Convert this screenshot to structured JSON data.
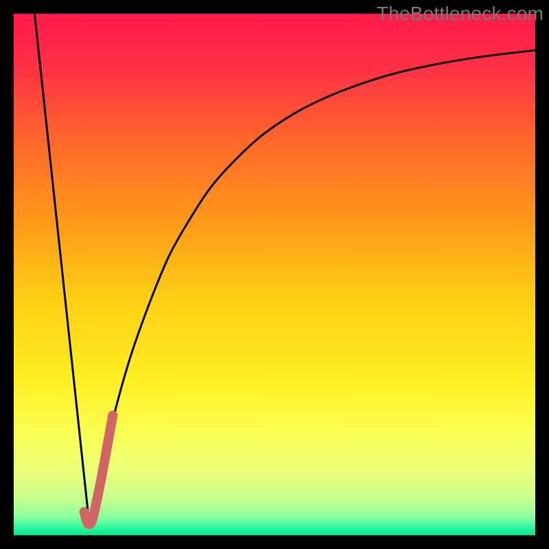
{
  "watermark": "TheBottleneck.com",
  "chart_data": {
    "type": "line",
    "title": "",
    "xlabel": "",
    "ylabel": "",
    "xlim": [
      0,
      100
    ],
    "ylim": [
      0,
      100
    ],
    "grid": false,
    "legend": false,
    "gradient_stops": [
      {
        "offset": 0.0,
        "color": "#ff1a4b"
      },
      {
        "offset": 0.1,
        "color": "#ff2f45"
      },
      {
        "offset": 0.25,
        "color": "#ff6a2a"
      },
      {
        "offset": 0.4,
        "color": "#ff9a1a"
      },
      {
        "offset": 0.55,
        "color": "#ffd014"
      },
      {
        "offset": 0.7,
        "color": "#ffee22"
      },
      {
        "offset": 0.8,
        "color": "#fbff51"
      },
      {
        "offset": 0.88,
        "color": "#eaff7a"
      },
      {
        "offset": 0.93,
        "color": "#c7ff8e"
      },
      {
        "offset": 0.965,
        "color": "#8affa0"
      },
      {
        "offset": 0.985,
        "color": "#2ff7a1"
      },
      {
        "offset": 1.0,
        "color": "#00e884"
      }
    ],
    "series": [
      {
        "name": "left-line",
        "stroke": "#000000",
        "stroke_width": 3,
        "x": [
          4,
          14.5
        ],
        "y": [
          100,
          2
        ]
      },
      {
        "name": "right-curve",
        "stroke": "#000000",
        "stroke_width": 3,
        "x": [
          14.5,
          16,
          18,
          20,
          22,
          24,
          27,
          30,
          34,
          38,
          43,
          48,
          54,
          60,
          67,
          74,
          82,
          90,
          100
        ],
        "y": [
          2,
          9,
          18,
          26,
          33,
          39,
          47,
          54,
          61,
          67,
          72.5,
          77,
          81,
          84,
          86.7,
          88.8,
          90.5,
          91.8,
          93
        ]
      },
      {
        "name": "red-overlay",
        "stroke": "#d16565",
        "stroke_width": 14,
        "linecap": "round",
        "x": [
          13.5,
          14.2,
          15.0,
          16.0,
          17.0,
          18.0,
          19.0
        ],
        "y": [
          4.5,
          2.3,
          2.8,
          7.0,
          12.0,
          17.5,
          23.0
        ]
      }
    ]
  }
}
